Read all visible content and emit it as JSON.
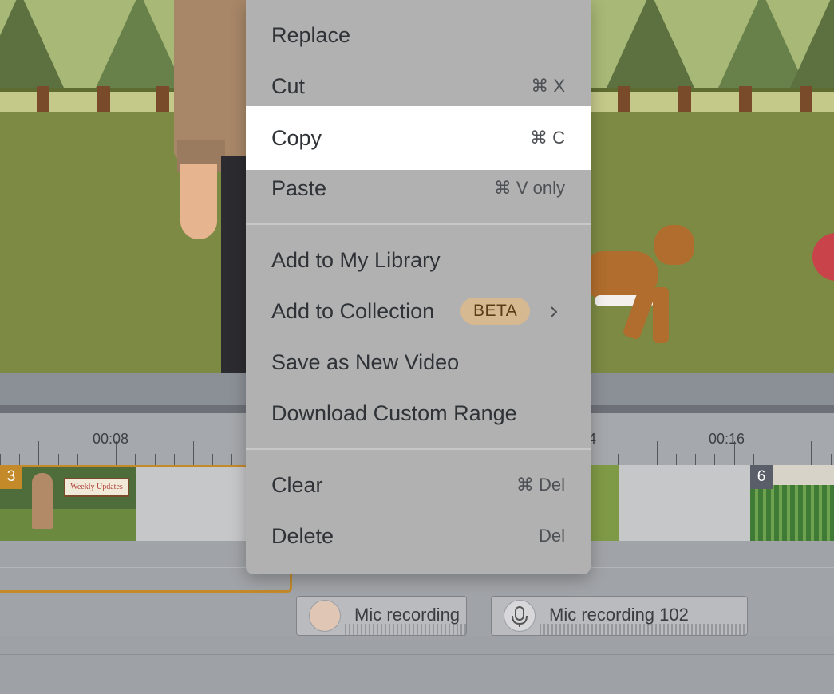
{
  "context_menu": {
    "items": [
      {
        "label": "Replace",
        "shortcut": ""
      },
      {
        "label": "Cut",
        "shortcut": "⌘ X"
      },
      {
        "label": "Copy",
        "shortcut": "⌘ C"
      },
      {
        "label": "Paste",
        "shortcut": "⌘ V only"
      },
      {
        "label": "Add to My Library",
        "shortcut": ""
      },
      {
        "label": "Add to Collection",
        "badge": "BETA",
        "submenu_icon": "chevron-right-icon"
      },
      {
        "label": "Save as New Video",
        "shortcut": ""
      },
      {
        "label": "Download Custom Range",
        "shortcut": ""
      },
      {
        "label": "Clear",
        "shortcut": "⌘ Del"
      },
      {
        "label": "Delete",
        "shortcut": "Del"
      }
    ],
    "highlighted": "Copy"
  },
  "timeline": {
    "ruler_labels": [
      "00:08",
      "4",
      "00:16"
    ],
    "clips": [
      {
        "number": "3",
        "thumbnail_text": "Weekly Updates"
      },
      {
        "number": "6"
      }
    ],
    "audio_clips": [
      {
        "label": "Mic recording",
        "icon": "avatar-icon"
      },
      {
        "label": "Mic recording 102",
        "icon": "microphone-icon"
      }
    ]
  },
  "colors": {
    "menu_bg": "#b1b1b1",
    "menu_highlight": "#ffffff",
    "beta_badge": "#d6b891",
    "selected_clip_border": "#c48a2a"
  }
}
